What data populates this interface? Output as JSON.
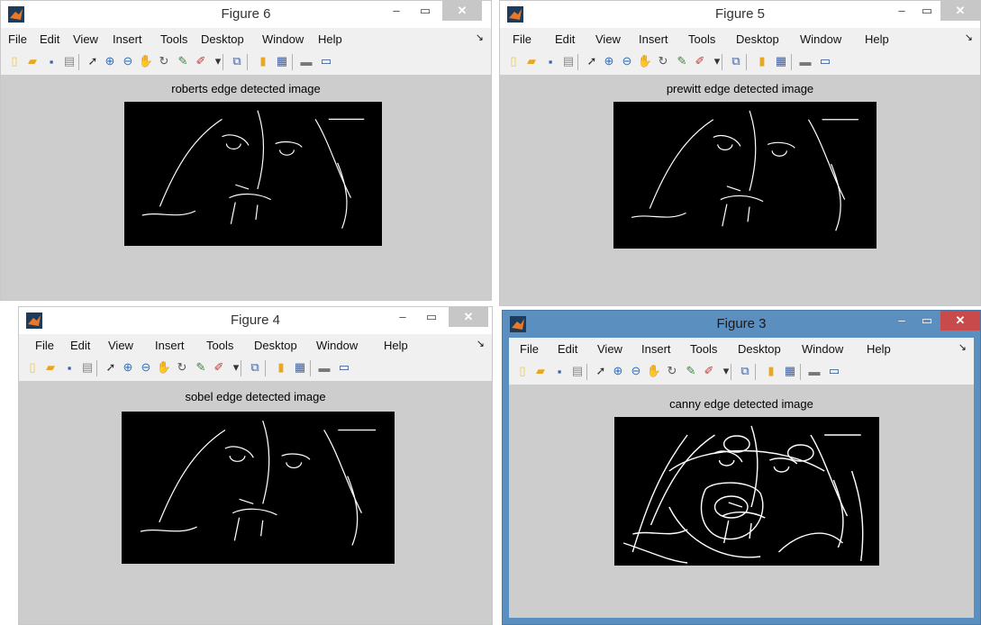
{
  "menu": [
    "File",
    "Edit",
    "View",
    "Insert",
    "Tools",
    "Desktop",
    "Window",
    "Help"
  ],
  "menu_arrow": "↘",
  "windows": {
    "fig6": {
      "title": "Figure 6",
      "plot_title": "roberts edge detected image"
    },
    "fig5": {
      "title": "Figure 5",
      "plot_title": "prewitt edge detected image"
    },
    "fig4": {
      "title": "Figure 4",
      "plot_title": "sobel edge detected image"
    },
    "fig3": {
      "title": "Figure 3",
      "plot_title": "canny edge detected image"
    }
  },
  "controls": {
    "minimize": "–",
    "maximize": "▭",
    "close": "✕"
  },
  "toolbar_icons": [
    "new-figure-icon",
    "open-file-icon",
    "save-icon",
    "print-icon",
    "pointer-icon",
    "zoom-in-icon",
    "zoom-out-icon",
    "pan-icon",
    "rotate-3d-icon",
    "data-cursor-icon",
    "brush-icon",
    "dropdown-arrow-icon",
    "link-plot-icon",
    "colorbar-icon",
    "legend-icon",
    "hide-plot-tools-icon",
    "show-plot-tools-icon"
  ],
  "colors": {
    "active_frame": "#5b8fbf",
    "canvas": "#cdcdcd",
    "close_active": "#c94a4a"
  }
}
